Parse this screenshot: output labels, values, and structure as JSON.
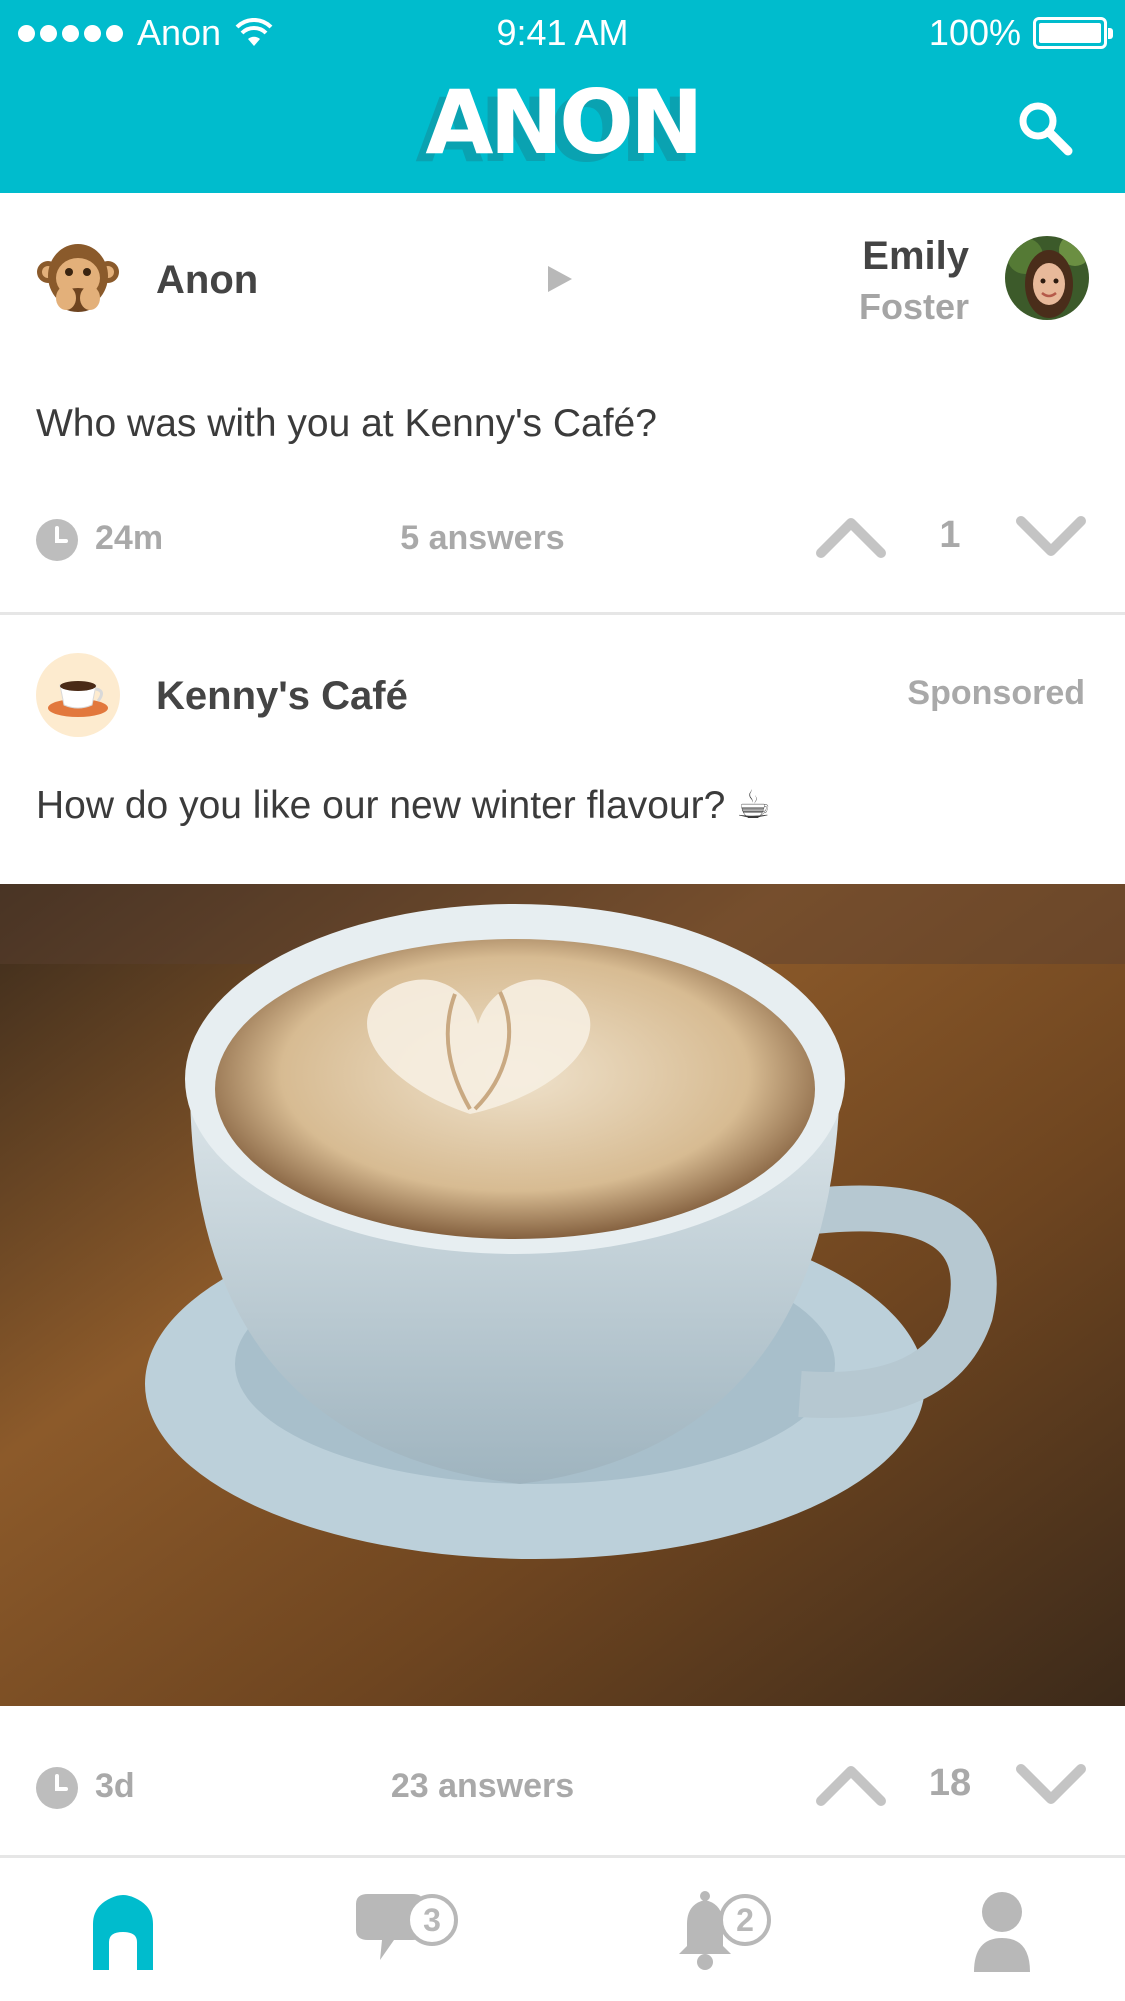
{
  "status_bar": {
    "carrier": "Anon",
    "time": "9:41 AM",
    "battery": "100%"
  },
  "header": {
    "logo": "ANON",
    "brand_color": "#00BCCD"
  },
  "posts": [
    {
      "author": "Anon",
      "author_icon": "see-no-evil-monkey-icon",
      "recipient_first": "Emily",
      "recipient_last": "Foster",
      "text": "Who was with you at Kenny's Café?",
      "age": "24m",
      "answers": "5 answers",
      "votes": "1"
    },
    {
      "author": "Kenny's Café",
      "author_icon": "coffee-cup-icon",
      "tag": "Sponsored",
      "text": "How do you like our new winter flavour? ☕",
      "image": "latte-art-coffee-photo",
      "age": "3d",
      "answers": "23 answers",
      "votes": "18"
    }
  ],
  "tabbar": {
    "active_color": "#00BCCD",
    "inactive_color": "#b8b8b8",
    "messages_badge": "3",
    "notifications_badge": "2"
  }
}
